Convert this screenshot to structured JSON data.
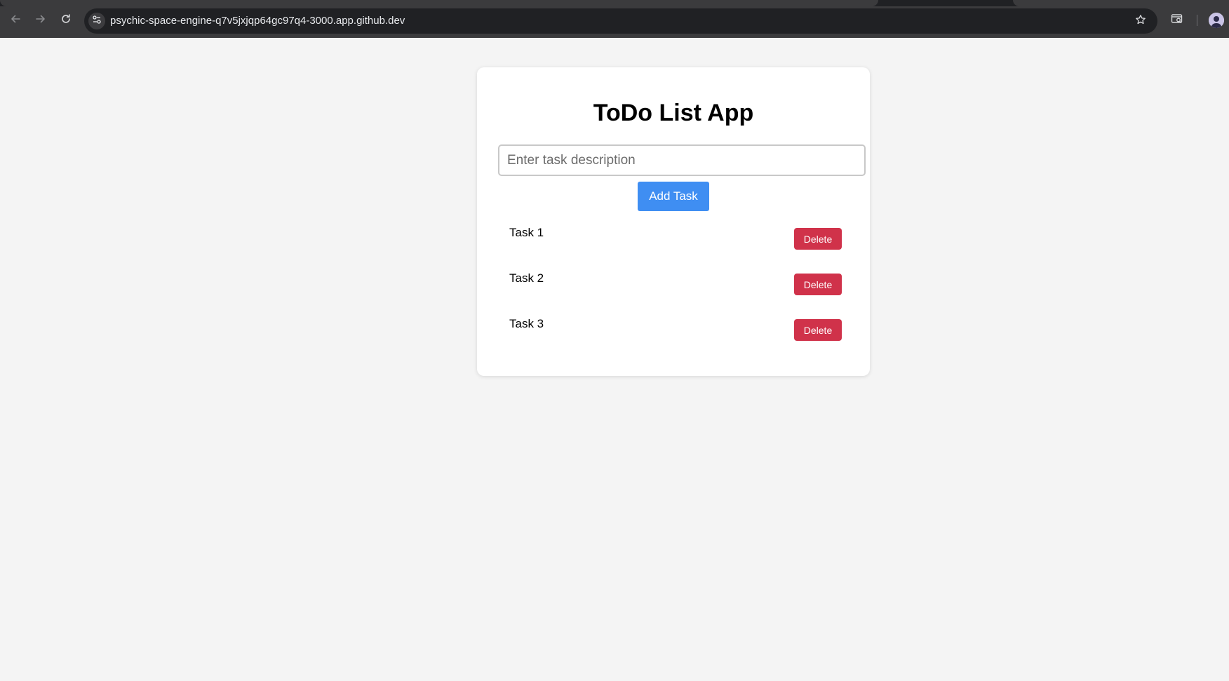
{
  "browser": {
    "url": "psychic-space-engine-q7v5jxjqp64gc97q4-3000.app.github.dev",
    "icons": {
      "back": "arrow-left-icon",
      "forward": "arrow-right-icon",
      "reload": "reload-icon",
      "site_info": "tune-icon",
      "bookmark": "star-icon",
      "search_tab": "tab-search-icon",
      "profile": "avatar"
    }
  },
  "app": {
    "title": "ToDo List App",
    "input": {
      "placeholder": "Enter task description",
      "value": ""
    },
    "add_button_label": "Add Task",
    "tasks": [
      {
        "text": "Task 1",
        "delete_label": "Delete"
      },
      {
        "text": "Task 2",
        "delete_label": "Delete"
      },
      {
        "text": "Task 3",
        "delete_label": "Delete"
      }
    ]
  },
  "colors": {
    "page_background": "#f4f4f4",
    "add_button": "#3f8ef2",
    "delete_button": "#d0324a",
    "chrome_toolbar": "#3b3b3d"
  }
}
